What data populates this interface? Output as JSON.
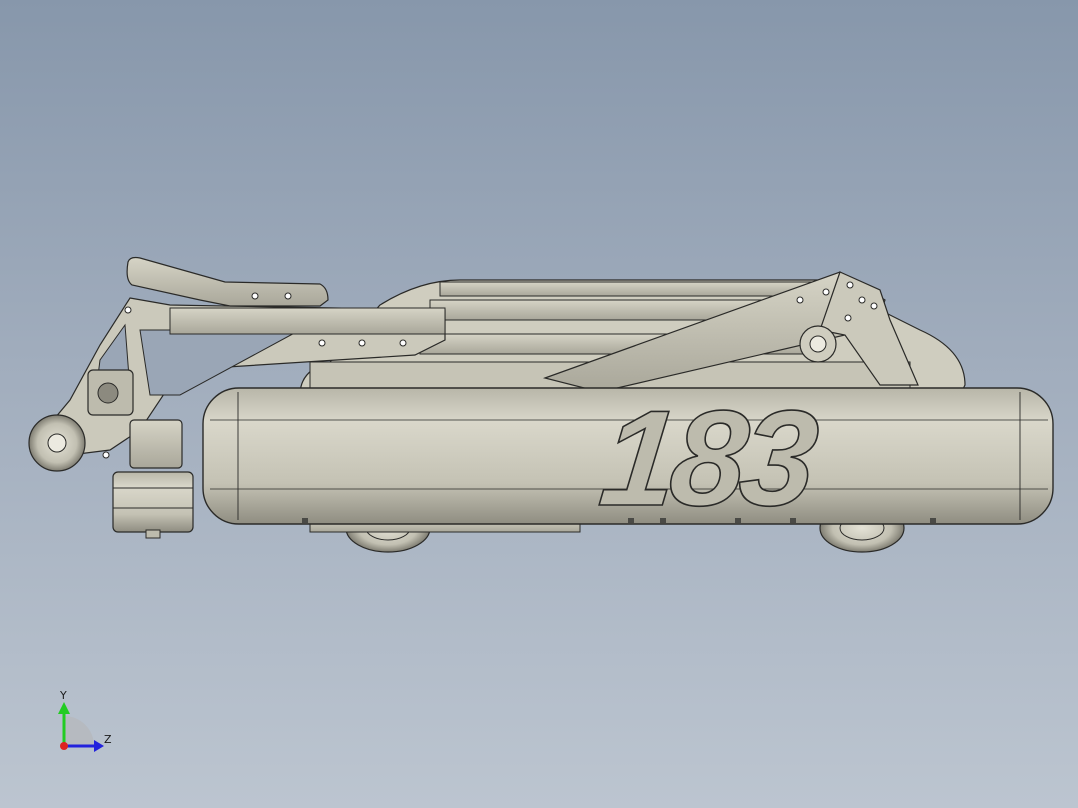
{
  "viewport": {
    "background_top": "#8797ab",
    "background_bottom": "#bcc5d0"
  },
  "model": {
    "number_label": "183",
    "body_color": "#c9c7b8",
    "shadow_color": "#9e9c8f",
    "outline_color": "#2a2a28"
  },
  "triad": {
    "y_label": "Y",
    "z_label": "Z",
    "y_color": "#22cc22",
    "z_color": "#2222dd",
    "x_color": "#dd2222"
  }
}
